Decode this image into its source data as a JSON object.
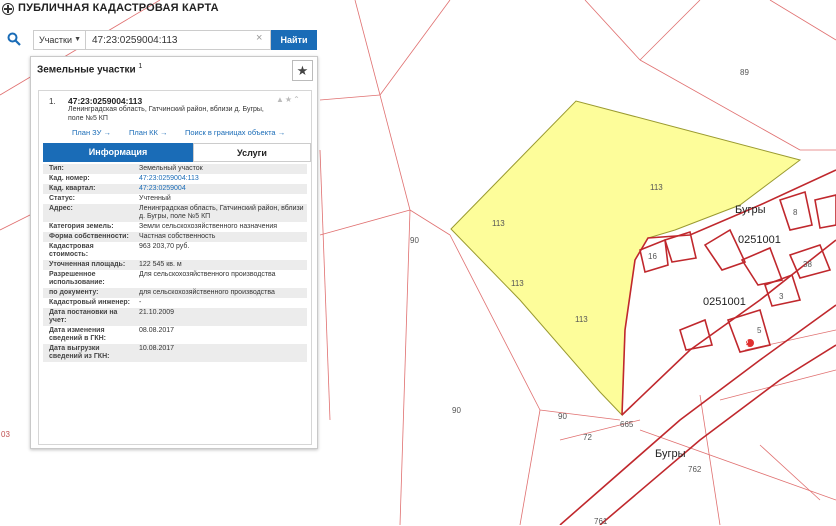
{
  "header": {
    "title": "ПУБЛИЧНАЯ КАДАСТРОВАЯ КАРТА"
  },
  "search": {
    "type_label": "Участки",
    "query": "47:23:0259004:113",
    "find_label": "Найти"
  },
  "panel": {
    "title": "Земельные участки",
    "count": "1",
    "item": {
      "number": "1.",
      "cad_number": "47:23:0259004:113",
      "address": "Ленинградская область, Гатчинский район, вблизи д. Бугры, поле №5 КП",
      "links": {
        "plan_zu": "План ЗУ →",
        "plan_kk": "План КК →",
        "search_bounds": "Поиск в границах объекта →"
      },
      "tabs": {
        "info": "Информация",
        "services": "Услуги"
      },
      "attributes": [
        {
          "key": "Тип:",
          "value": "Земельный участок"
        },
        {
          "key": "Кад. номер:",
          "value": "47:23:0259004:113",
          "link": true
        },
        {
          "key": "Кад. квартал:",
          "value": "47:23:0259004",
          "link": true
        },
        {
          "key": "Статус:",
          "value": "Учтенный"
        },
        {
          "key": "Адрес:",
          "value": "Ленинградская область, Гатчинский район, вблизи д. Бугры, поле №5 КП"
        },
        {
          "key": "Категория земель:",
          "value": "Земли сельскохозяйственного назначения"
        },
        {
          "key": "Форма собственности:",
          "value": "Частная собственность"
        },
        {
          "key": "Кадастровая стоимость:",
          "value": "963 203,70 руб."
        },
        {
          "key": "Уточненная площадь:",
          "value": "122 545 кв. м"
        },
        {
          "key": "Разрешенное использование:",
          "value": "Для сельскохозяйственного производства"
        },
        {
          "key": "по документу:",
          "value": "для сельскохозяйственного производства"
        },
        {
          "key": "Кадастровый инженер:",
          "value": "-"
        },
        {
          "key": "Дата постановки на учет:",
          "value": "21.10.2009"
        },
        {
          "key": "Дата изменения сведений в ГКН:",
          "value": "08.08.2017"
        },
        {
          "key": "Дата выгрузки сведений из ГКН:",
          "value": "10.08.2017"
        }
      ]
    }
  },
  "map": {
    "labels": {
      "n89": "89",
      "n90a": "90",
      "n90b": "90",
      "n90c": "90",
      "n03": "03",
      "n113a": "113",
      "n113b": "113",
      "n113c": "113",
      "n113d": "113",
      "bugry1": "Бугры",
      "bugry2": "Бугры",
      "q1": "0251001",
      "q2": "0251001",
      "n8": "8",
      "n16": "16",
      "n38": "38",
      "n3": "3",
      "n5": "5",
      "n2": "2",
      "n72": "72",
      "n665": "665",
      "n762": "762",
      "n761": "761"
    },
    "colors": {
      "selected_fill": "#fdfd9a",
      "selected_stroke": "#c0282d",
      "boundary": "#e07070"
    }
  }
}
